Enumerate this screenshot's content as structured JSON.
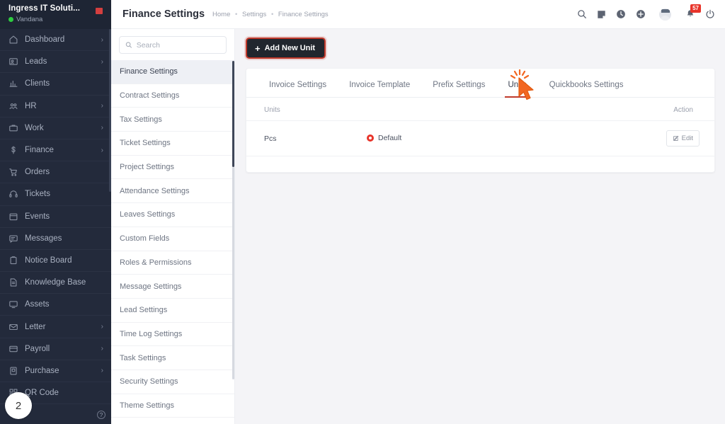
{
  "sidebar": {
    "company": "Ingress IT Soluti...",
    "username": "Vandana",
    "status_icon": "green-status-dot",
    "logo_text": "",
    "items": [
      {
        "label": "Dashboard",
        "icon": "home-icon",
        "chevron": "›"
      },
      {
        "label": "Leads",
        "icon": "id-card-icon",
        "chevron": "›"
      },
      {
        "label": "Clients",
        "icon": "bar-chart-icon",
        "chevron": ""
      },
      {
        "label": "HR",
        "icon": "users-icon",
        "chevron": "›"
      },
      {
        "label": "Work",
        "icon": "briefcase-icon",
        "chevron": "›"
      },
      {
        "label": "Finance",
        "icon": "dollar-icon",
        "chevron": "›"
      },
      {
        "label": "Orders",
        "icon": "shopping-cart-icon",
        "chevron": ""
      },
      {
        "label": "Tickets",
        "icon": "headset-icon",
        "chevron": ""
      },
      {
        "label": "Events",
        "icon": "calendar-icon",
        "chevron": ""
      },
      {
        "label": "Messages",
        "icon": "message-icon",
        "chevron": ""
      },
      {
        "label": "Notice Board",
        "icon": "clipboard-icon",
        "chevron": ""
      },
      {
        "label": "Knowledge Base",
        "icon": "document-icon",
        "chevron": ""
      },
      {
        "label": "Assets",
        "icon": "monitor-icon",
        "chevron": ""
      },
      {
        "label": "Letter",
        "icon": "envelope-icon",
        "chevron": "›"
      },
      {
        "label": "Payroll",
        "icon": "wallet-icon",
        "chevron": "›"
      },
      {
        "label": "Purchase",
        "icon": "purchase-icon",
        "chevron": "›"
      },
      {
        "label": "QR Code",
        "icon": "qr-code-icon",
        "chevron": ""
      }
    ],
    "help_icon": "help-circle-icon",
    "step_badge": "2"
  },
  "topbar": {
    "title": "Finance Settings",
    "breadcrumbs": [
      "Home",
      "Settings",
      "Finance Settings"
    ],
    "separator": "•",
    "icons": [
      {
        "name": "search-icon"
      },
      {
        "name": "note-icon"
      },
      {
        "name": "clock-icon"
      },
      {
        "name": "plus-circle-icon"
      }
    ],
    "avatar": "user-avatar",
    "bell_icon": "bell-icon",
    "notification_count": "57",
    "power_icon": "power-icon"
  },
  "settings_nav": {
    "search_placeholder": "Search",
    "search_value": "",
    "search_icon": "search-icon",
    "items": [
      {
        "label": "Finance Settings",
        "active": true
      },
      {
        "label": "Contract Settings",
        "active": false
      },
      {
        "label": "Tax Settings",
        "active": false
      },
      {
        "label": "Ticket Settings",
        "active": false
      },
      {
        "label": "Project Settings",
        "active": false
      },
      {
        "label": "Attendance Settings",
        "active": false
      },
      {
        "label": "Leaves Settings",
        "active": false
      },
      {
        "label": "Custom Fields",
        "active": false
      },
      {
        "label": "Roles & Permissions",
        "active": false
      },
      {
        "label": "Message Settings",
        "active": false
      },
      {
        "label": "Lead Settings",
        "active": false
      },
      {
        "label": "Time Log Settings",
        "active": false
      },
      {
        "label": "Task Settings",
        "active": false
      },
      {
        "label": "Security Settings",
        "active": false
      },
      {
        "label": "Theme Settings",
        "active": false
      }
    ]
  },
  "main": {
    "add_button_label": "Add New Unit",
    "add_button_icon": "plus-icon",
    "tabs": [
      {
        "label": "Invoice Settings",
        "active": false
      },
      {
        "label": "Invoice Template",
        "active": false
      },
      {
        "label": "Prefix Settings",
        "active": false
      },
      {
        "label": "Units",
        "active": true
      },
      {
        "label": "Quickbooks Settings",
        "active": false
      }
    ],
    "table": {
      "columns": [
        "Units",
        "",
        "Action"
      ],
      "rows": [
        {
          "unit": "Pcs",
          "badge": "Default",
          "badge_icon": "record-dot-icon",
          "action_label": "Edit",
          "action_icon": "edit-pencil-icon"
        }
      ]
    }
  },
  "colors": {
    "sidebar_bg": "#232a3b",
    "accent_red": "#c0392b",
    "badge_red": "#e8342a",
    "cursor_orange": "#f26722",
    "page_bg": "#f4f4f7"
  }
}
